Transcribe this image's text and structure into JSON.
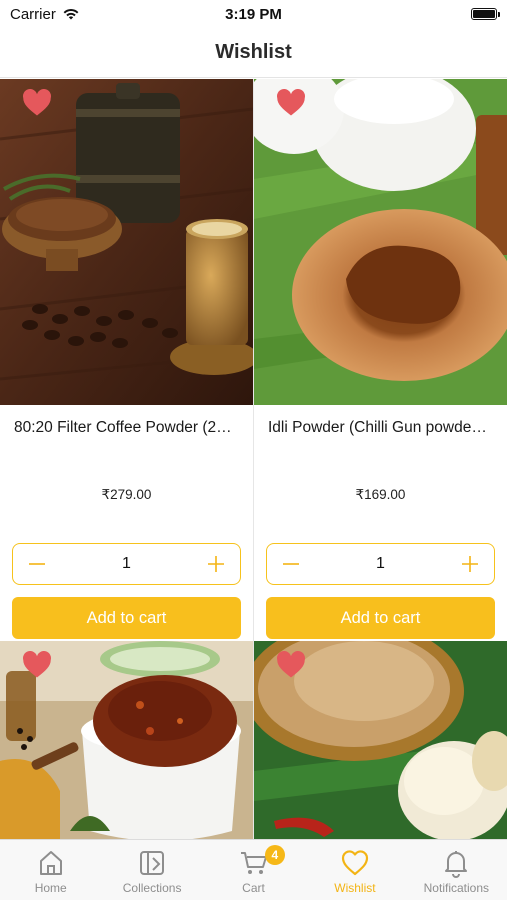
{
  "status_bar": {
    "carrier": "Carrier",
    "time": "3:19 PM"
  },
  "header": {
    "title": "Wishlist"
  },
  "colors": {
    "accent": "#F8BF1D",
    "heart": "#E5585C",
    "inactive_tab": "#8E8E8E"
  },
  "products": [
    {
      "name": "80:20 Filter Coffee Powder (2…",
      "price": "₹279.00",
      "quantity": "1",
      "add_label": "Add to cart",
      "wishlisted": true,
      "image": "filter-coffee-photo"
    },
    {
      "name": "Idli Powder (Chilli Gun powde…",
      "price": "₹169.00",
      "quantity": "1",
      "add_label": "Add to cart",
      "wishlisted": true,
      "image": "idli-powder-photo"
    },
    {
      "wishlisted": true,
      "image": "pickle-photo"
    },
    {
      "wishlisted": true,
      "image": "appalam-photo"
    }
  ],
  "tabs": [
    {
      "label": "Home",
      "icon": "home-icon",
      "active": false
    },
    {
      "label": "Collections",
      "icon": "collections-icon",
      "active": false
    },
    {
      "label": "Cart",
      "icon": "cart-icon",
      "active": false,
      "badge": "4"
    },
    {
      "label": "Wishlist",
      "icon": "heart-icon",
      "active": true
    },
    {
      "label": "Notifications",
      "icon": "bell-icon",
      "active": false
    }
  ]
}
